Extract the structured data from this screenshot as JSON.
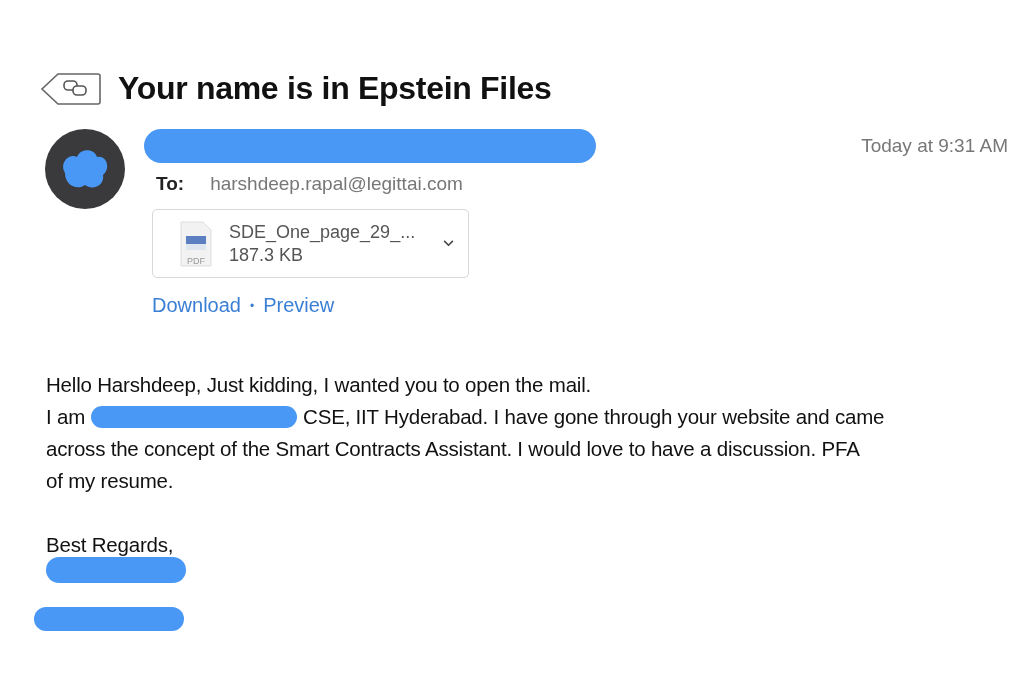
{
  "message": {
    "subject": "Your name is in Epstein Files",
    "date": "Today at 9:31 AM",
    "to_label": "To:",
    "to": "harshdeep.rapal@legittai.com",
    "attachment": {
      "name": "SDE_One_page_29_...",
      "size": "187.3 KB",
      "file_type": "PDF"
    },
    "actions": [
      "Download",
      "Preview"
    ],
    "separator": "•",
    "body": {
      "greeting": "Hello Harshdeep, Just kidding, I wanted you to open the mail.",
      "intro_start": "I am",
      "intro_lines": [
        "CSE, IIT Hyderabad. I have gone through your website and came",
        "across the concept of the Smart Contracts Assistant. I would love to have a discussion. PFA",
        "of my resume."
      ],
      "closing": "Best Regards,"
    }
  }
}
